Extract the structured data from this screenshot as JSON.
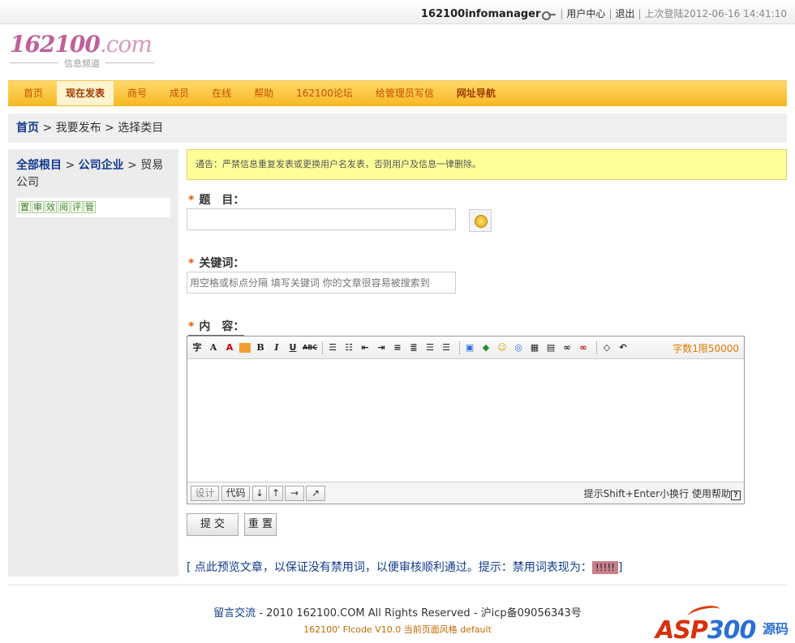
{
  "topbar": {
    "username": "162100infomanager",
    "user_center": "用户中心",
    "logout": "退出",
    "last_login": "上次登陆2012-06-16 14:41:10"
  },
  "logo": {
    "brand_main": "162100",
    "brand_com": ".com",
    "subtitle": "信息频道"
  },
  "nav": {
    "items": [
      {
        "label": "首页"
      },
      {
        "label": "现在发表"
      },
      {
        "label": "商号"
      },
      {
        "label": "成员"
      },
      {
        "label": "在线"
      },
      {
        "label": "帮助"
      },
      {
        "label": "162100论坛"
      },
      {
        "label": "给管理员写信"
      },
      {
        "label": "网址导航"
      }
    ]
  },
  "breadcrumb": {
    "home": "首页",
    "sep": " > ",
    "step1": "我要发布",
    "step2": "选择类目"
  },
  "sidebar": {
    "root": "全部根目",
    "cat": "公司企业",
    "sep": " > ",
    "sub": "贸易公司",
    "tools": [
      "置",
      "审",
      "效",
      "阅",
      "评",
      "管"
    ]
  },
  "notice": "通告：严禁信息重复发表或更换用户名发表，否则用户及信息一律删除。",
  "form": {
    "title_label": "题　目：",
    "keywords_label": "关键词：",
    "keywords_placeholder": "用空格或标点分隔 填写关键词 你的文章很容易被搜索到",
    "content_label": "内　容：",
    "char_count": "字数1限50000",
    "design_btn": "设计",
    "code_btn": "代码",
    "hint": "提示Shift+Enter小换行",
    "help": "使用帮助",
    "qmark": "?",
    "submit": "提 交",
    "reset": "重 置"
  },
  "preview": {
    "text": "[ 点此预览文章，以保证没有禁用词，以便审核顺利通过。提示：禁用词表现为：",
    "sample": "!!!!!",
    "close": "]"
  },
  "footer": {
    "link": "留言交流",
    "rights": " - 2010 162100.COM All Rights Reserved - 沪icp备09056343号",
    "version": "162100' FIcode V10.0 当前页面风格 default"
  },
  "watermark": {
    "asp": "ASP",
    "num": "300",
    "cn": "源码"
  }
}
